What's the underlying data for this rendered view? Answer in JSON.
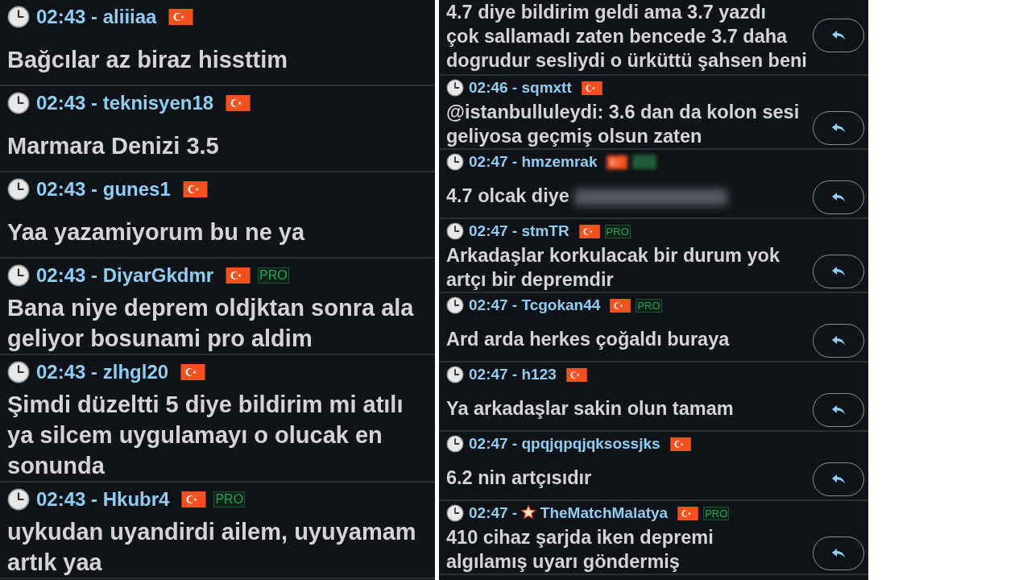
{
  "panels": [
    {
      "messages": [
        {
          "time": "02:43 -",
          "user": "aliiiaa",
          "pro": false,
          "lines": [
            "Bağcılar az biraz hissttim"
          ]
        },
        {
          "time": "02:43 -",
          "user": "teknisyen18",
          "pro": false,
          "lines": [
            "Marmara Denizi 3.5"
          ]
        },
        {
          "time": "02:43 -",
          "user": "gunes1",
          "pro": false,
          "lines": [
            "Yaa yazamiyorum bu ne ya"
          ]
        },
        {
          "time": "02:43 -",
          "user": "DiyarGkdmr",
          "pro": true,
          "pro_label": "PRO",
          "lines": [
            "Bana niye deprem oldjktan sonra ala",
            "geliyor bosunami pro aldim"
          ]
        },
        {
          "time": "02:43 -",
          "user": "zlhgl20",
          "pro": false,
          "lines": [
            "Şimdi düzeltti 5 diye bildirim mi atılı",
            "ya silcem uygulamayı o olucak en",
            "sonunda"
          ]
        },
        {
          "time": "02:43 -",
          "user": "Hkubr4",
          "pro": true,
          "pro_label": "PRO",
          "lines": [
            "uykudan uyandirdi ailem, uyuyamam",
            "artık yaa"
          ]
        }
      ]
    },
    {
      "messages": [
        {
          "lines": [
            "4.7 diye bildirim geldi ama 3.7 yazdı",
            "çok sallamadı zaten bencede 3.7 daha",
            "dogrudur sesliydi o ürküttü şahsen beni"
          ],
          "reply": true
        },
        {
          "time": "02:46 -",
          "user": "sqmxtt",
          "pro": false,
          "lines": [
            "@istanbulluleydi: 3.6 dan da kolon sesi",
            "geliyosa geçmiş olsun zaten"
          ],
          "reply": true
        },
        {
          "time": "02:47 -",
          "user": "hmzemrak",
          "pro": true,
          "blurred": true,
          "lines": [
            "4.7 olcak diye"
          ],
          "reply": true
        },
        {
          "time": "02:47 -",
          "user": "stmTR",
          "pro": true,
          "pro_label": "PRO",
          "lines": [
            "Arkadaşlar korkulacak bir durum yok",
            "artçı bir depremdir"
          ],
          "reply": true
        },
        {
          "time": "02:47 -",
          "user": "Tcgokan44",
          "pro": true,
          "pro_label": "PRO",
          "lines": [
            "Ard arda herkes çoğaldı buraya"
          ],
          "reply": true
        },
        {
          "time": "02:47 -",
          "user": "h123",
          "pro": false,
          "lines": [
            "Ya arkadaşlar sakin olun tamam"
          ],
          "reply": true
        },
        {
          "time": "02:47 -",
          "user": "qpqjqpqjqksossjks",
          "pro": false,
          "lines": [
            "6.2 nin artçısıdır"
          ],
          "reply": true
        },
        {
          "time": "02:47 -",
          "user": "TheMatchMalatya",
          "star": true,
          "pro": true,
          "pro_label": "PRO",
          "lines": [
            "410 cihaz şarjda iken depremi",
            "algılamış uyarı göndermiş"
          ],
          "reply": true
        }
      ]
    }
  ]
}
